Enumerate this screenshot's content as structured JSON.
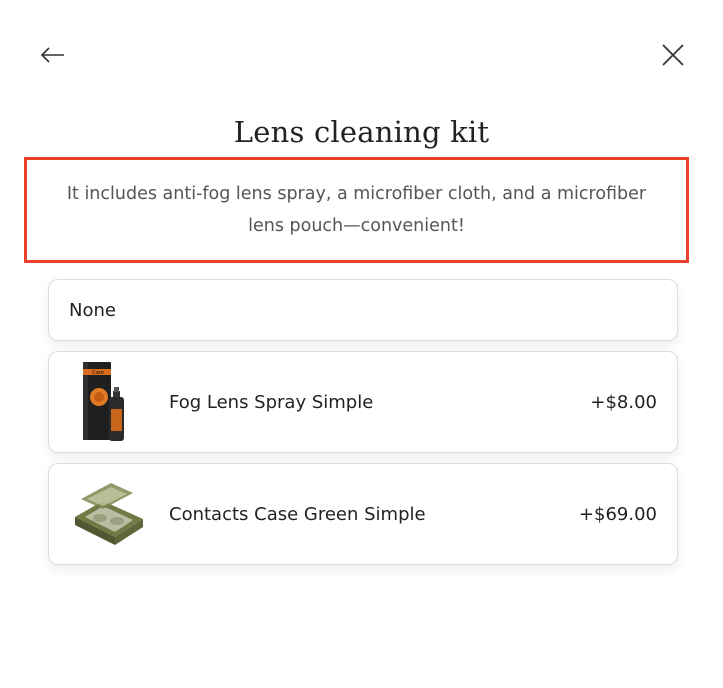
{
  "header": {
    "back_icon": "arrow-left-icon",
    "close_icon": "close-icon"
  },
  "title": "Lens cleaning kit",
  "description": "It includes anti-fog lens spray, a microfiber cloth, and a microfiber lens pouch—convenient!",
  "options": [
    {
      "label": "None"
    },
    {
      "label": "Fog Lens Spray Simple",
      "price": "+$8.00",
      "image": "spray-box-image"
    },
    {
      "label": "Contacts Case Green Simple",
      "price": "+$69.00",
      "image": "contacts-case-image"
    }
  ],
  "colors": {
    "highlight_border": "#e8402a",
    "text": "#222222",
    "description_text": "#555555",
    "card_border": "#dcdcdc"
  }
}
